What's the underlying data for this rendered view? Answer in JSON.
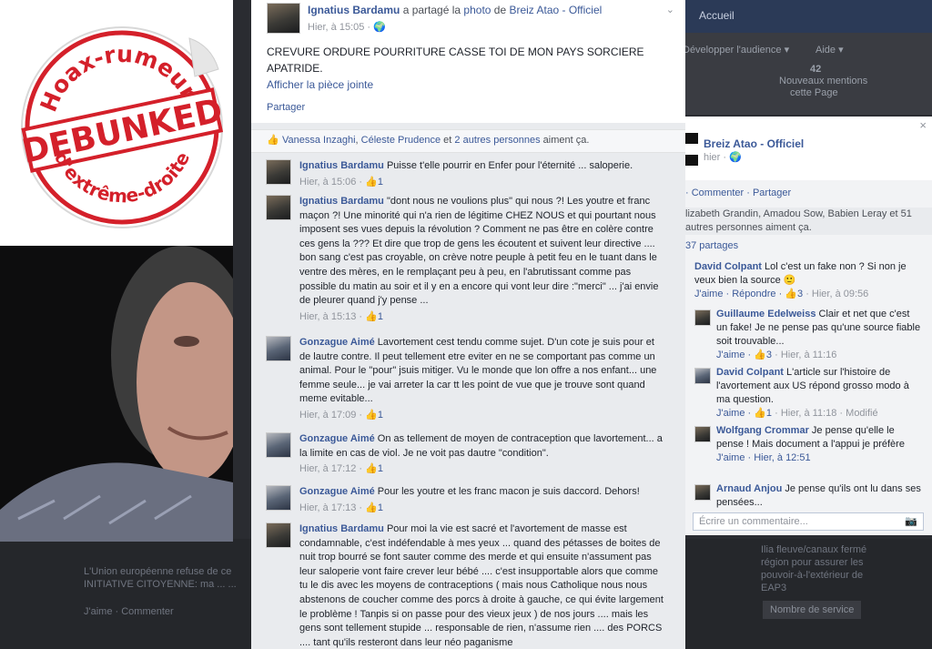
{
  "background": {
    "topbar": {
      "item_1": "Accueil"
    },
    "right_strip": {
      "line_1": "Développer l'audience ▾",
      "line_2": "Aide ▾",
      "line_3": "42",
      "line_4": "Nouveaux mentions",
      "line_5": "cette Page"
    },
    "bottom": {
      "left_text": "L'Union européenne refuse de ce",
      "left_text_2": "INITIATIVE CITOYENNE: ma ... ...",
      "actions": "J'aime · Commenter",
      "right_text_1": "Ilia fleuve/canaux fermé",
      "right_text_2": "région pour assurer les",
      "right_text_3": "pouvoir-à-l'extérieur de",
      "right_text_4": "EAP3",
      "right_btn": "Nombre de service"
    }
  },
  "sticker": {
    "top_text": "Hoax-rumeurs",
    "center_text": "DEBUNKED",
    "bottom_text": "d'extrême-droite"
  },
  "post": {
    "author": "Ignatius Bardamu",
    "shared_text": " a partagé la ",
    "shared_link": "photo",
    "shared_from_prefix": " de ",
    "shared_from": "Breiz Atao - Officiel",
    "time": "Hier, à 15:05 · ",
    "globe": "🌍",
    "message": "CREVURE ORDURE POURRITURE CASSE TOI DE MON PAYS SORCIERE APATRIDE.",
    "attachment_link": "Afficher la pièce jointe",
    "share": "Partager",
    "likes": {
      "name_1": "Vanessa Inzaghi",
      "sep": ", ",
      "name_2": "Céleste Prudence",
      "and": " et ",
      "others": "2 autres personnes",
      "suffix": " aiment ça."
    },
    "comments": [
      {
        "author": "Ignatius Bardamu",
        "text": "Puisse t'elle pourrir en Enfer pour l'éternité ... saloperie.",
        "time": "Hier, à 15:06 · ",
        "likes": "1"
      },
      {
        "author": "Ignatius Bardamu",
        "text": "\"dont nous ne voulions plus\" qui nous ?! Les youtre et franc maçon ?! Une minorité qui n'a rien de légitime CHEZ NOUS et qui pourtant nous imposent ses vues depuis la révolution ? Comment ne pas être en colère contre ces gens la ??? Et dire que trop de gens les écoutent et suivent leur directive .... bon sang c'est pas croyable, on crève notre peuple à petit feu en le tuant dans le ventre des mères, en le remplaçant peu à peu, en l'abrutissant comme pas possible du matin au soir et il y en a encore qui vont leur dire :\"merci\" ... j'ai envie de pleurer quand j'y pense ...",
        "time": "Hier, à 15:13 · ",
        "likes": "1"
      },
      {
        "author": "Gonzague Aimé",
        "text": "Lavortement cest tendu comme sujet. D'un cote je suis pour et de lautre contre. Il peut tellement etre eviter en ne se comportant pas comme un animal. Pour le \"pour\" jsuis mitiger. Vu le monde que lon offre a nos enfant... une femme seule... je vai arreter la car tt les point de vue que je trouve sont quand meme evitable...",
        "time": "Hier, à 17:09 · ",
        "likes": "1"
      },
      {
        "author": "Gonzague Aimé",
        "text": "On as tellement de moyen de contraception que lavortement... a la limite en cas de viol. Je ne voit pas dautre \"condition\".",
        "time": "Hier, à 17:12 · ",
        "likes": "1"
      },
      {
        "author": "Gonzague Aimé",
        "text": "Pour les youtre et les franc macon je suis daccord. Dehors!",
        "time": "Hier, à 17:13 · ",
        "likes": "1"
      },
      {
        "author": "Ignatius Bardamu",
        "text": "Pour moi la vie est sacré et l'avortement de masse est condamnable, c'est indéfendable à mes yeux ... quand des pétasses de boites de nuit trop bourré se font sauter comme des merde et qui ensuite n'assument pas leur saloperie vont faire crever leur bébé .... c'est insupportable alors que comme tu le dis avec les moyens de contraceptions ( mais nous Catholique nous nous abstenons de coucher comme des porcs à droite à gauche, ce qui évite largement le problème ! Tanpis si on passe pour des vieux jeux ) de nos jours .... mais les gens sont tellement stupide ... responsable de rien, n'assume rien .... des PORCS .... tant qu'ils resteront dans leur néo paganisme",
        "time": "",
        "likes": ""
      }
    ]
  },
  "right_panel": {
    "page_name": "Breiz Atao - Officiel",
    "time": "hier · ",
    "actions": "· Commenter · Partager",
    "likes_text": "lizabeth Grandin, Amadou Sow, Babien Leray et 51 autres personnes aiment ça.",
    "shares": "37 partages",
    "close": "×",
    "comments": [
      {
        "author": "David Colpant",
        "text": "Lol c'est un fake non ? Si non je veux bien la source 🙂",
        "actions": "J'aime · Répondre · ",
        "likes": "3",
        "time": " · Hier, à 09:56"
      },
      {
        "author": "Guillaume Edelweiss",
        "text": "Clair et net que c'est un fake! Je ne pense pas qu'une source fiable soit trouvable...",
        "actions": "J'aime · ",
        "likes": "3",
        "time": " · Hier, à 11:16"
      },
      {
        "author": "David Colpant",
        "text": "L'article sur l'histoire de l'avortement aux US répond grosso modo à ma question.",
        "actions": "J'aime · ",
        "likes": "1",
        "time": " · Hier, à 11:18 · Modifié"
      },
      {
        "author": "Wolfgang Crommar",
        "text": "Je pense qu'elle le pense ! Mais document a l'appui je préfère",
        "actions": "J'aime · Hier, à 12:51",
        "likes": "",
        "time": ""
      },
      {
        "author": "Arnaud Anjou",
        "text": "Je pense qu'ils ont lu dans ses pensées...",
        "actions": "",
        "likes": "",
        "time": ""
      }
    ],
    "comment_placeholder": "Écrire un commentaire...",
    "camera": "📷"
  },
  "colors": {
    "fb_blue": "#3b5998",
    "sticker_red": "#d4202a"
  }
}
